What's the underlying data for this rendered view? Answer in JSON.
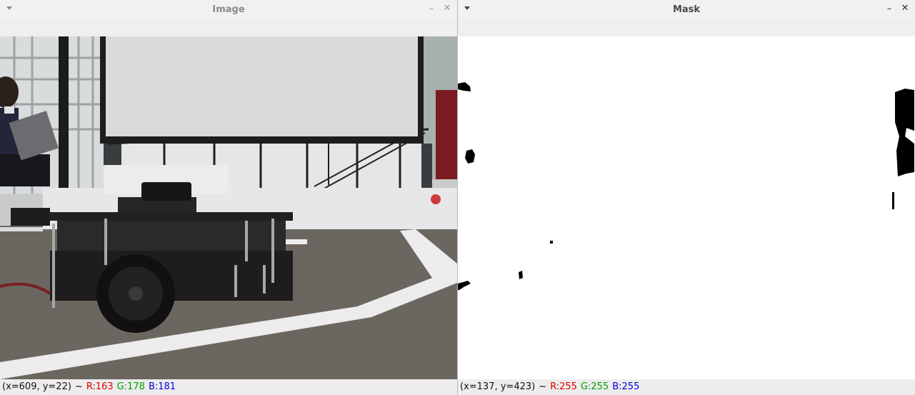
{
  "image_window": {
    "title": "Image",
    "status": {
      "coords": "(x=609, y=22)",
      "separator": "~",
      "r": "R:163",
      "g": "G:178",
      "b": "B:181"
    }
  },
  "mask_window": {
    "title": "Mask",
    "status": {
      "coords": "(x=137, y=423)",
      "separator": "~",
      "r": "R:255",
      "g": "G:255",
      "b": "B:255"
    }
  },
  "icons": {
    "menu": "chevron-down-icon",
    "minimize": "minimize-icon",
    "close": "close-icon"
  },
  "colors": {
    "red_channel": "#e00000",
    "green_channel": "#00a000",
    "blue_channel": "#0000e0"
  }
}
